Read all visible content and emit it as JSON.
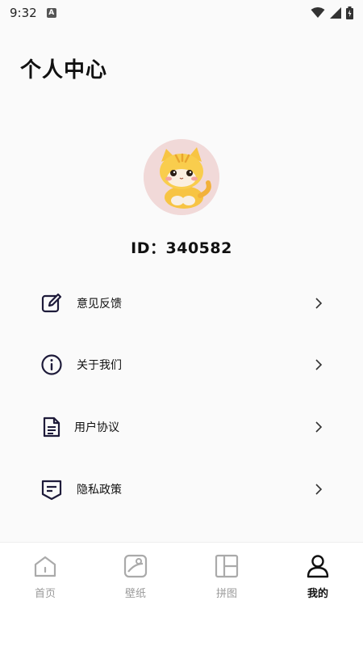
{
  "status_bar": {
    "time": "9:32",
    "notification_letter": "A",
    "icons": [
      "wifi-icon",
      "signal-icon",
      "battery-icon"
    ]
  },
  "page": {
    "title": "个人中心"
  },
  "profile": {
    "avatar": "cat-avatar",
    "id_text": "ID：340582"
  },
  "menu": [
    {
      "label": "意见反馈",
      "icon": "edit-icon"
    },
    {
      "label": "关于我们",
      "icon": "info-icon"
    },
    {
      "label": "用户协议",
      "icon": "document-icon"
    },
    {
      "label": "隐私政策",
      "icon": "shield-doc-icon"
    }
  ],
  "tabs": [
    {
      "label": "首页",
      "icon": "home-icon",
      "active": false
    },
    {
      "label": "壁纸",
      "icon": "wallpaper-icon",
      "active": false
    },
    {
      "label": "拼图",
      "icon": "collage-icon",
      "active": false
    },
    {
      "label": "我的",
      "icon": "user-icon",
      "active": true
    }
  ],
  "colors": {
    "background": "#fafafa",
    "icon_dark": "#1e1b3a",
    "tab_inactive": "#9a9a9a",
    "tab_active": "#111111"
  }
}
